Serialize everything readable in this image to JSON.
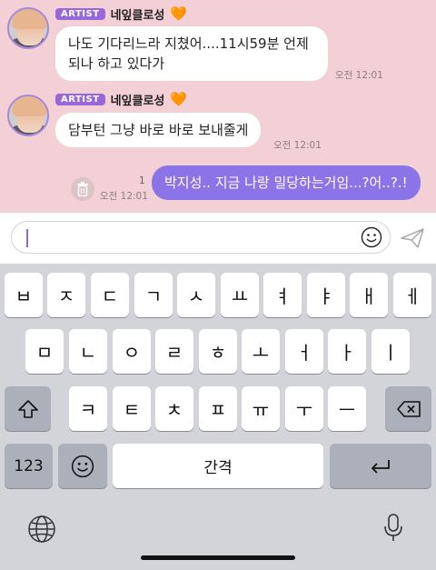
{
  "messages": [
    {
      "badge": "ARTIST",
      "sender": "네잎클로성",
      "heart": "🧡",
      "lines": [
        "나도 기다리느라 지쳤어....11시59분 언제",
        "되나 하고 있다가"
      ],
      "time": "오전 12:01"
    },
    {
      "badge": "ARTIST",
      "sender": "네잎클로성",
      "heart": "🧡",
      "lines": [
        "담부턴 그냥 바로 바로 보내줄게"
      ],
      "time": "오전 12:01"
    }
  ],
  "my_message": {
    "text": "박지성.. 지금 나랑 밀당하는거임...?어..?.!",
    "unread_count": "1",
    "time": "오전 12:01"
  },
  "keyboard": {
    "row1": [
      "ㅂ",
      "ㅈ",
      "ㄷ",
      "ㄱ",
      "ㅅ",
      "ㅛ",
      "ㅕ",
      "ㅑ",
      "ㅐ",
      "ㅔ"
    ],
    "row2": [
      "ㅁ",
      "ㄴ",
      "ㅇ",
      "ㄹ",
      "ㅎ",
      "ㅗ",
      "ㅓ",
      "ㅏ",
      "ㅣ"
    ],
    "row3": [
      "ㅋ",
      "ㅌ",
      "ㅊ",
      "ㅍ",
      "ㅠ",
      "ㅜ",
      "ㅡ"
    ],
    "num_label": "123",
    "space_label": "간격"
  },
  "icons": {
    "delete": "trash-icon",
    "emoji": "smiley-icon",
    "send": "paper-plane-icon",
    "shift": "shift-icon",
    "backspace": "backspace-icon",
    "return": "return-icon",
    "globe": "globe-icon",
    "mic": "microphone-icon"
  },
  "colors": {
    "chat_bg": "#f3cfd6",
    "badge": "#9867d8",
    "my_bubble": "#8b74e8",
    "caret": "#8f67e0"
  }
}
